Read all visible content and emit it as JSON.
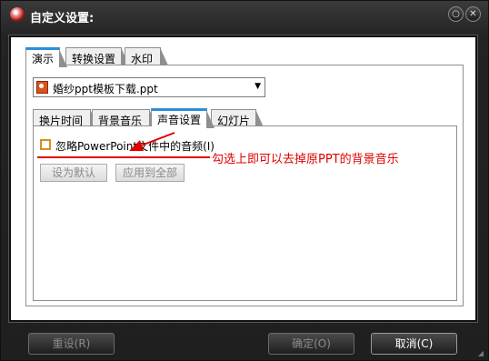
{
  "window": {
    "title": "自定义设置:",
    "min_symbol": "○",
    "close_symbol": "✕"
  },
  "main_tabs": [
    {
      "label": "演示",
      "active": true
    },
    {
      "label": "转换设置",
      "active": false
    },
    {
      "label": "水印",
      "active": false
    }
  ],
  "file_select": {
    "value": "婚纱ppt模板下载.ppt",
    "arrow": "▼"
  },
  "sub_tabs": [
    {
      "label": "换片时间",
      "active": false
    },
    {
      "label": "背景音乐",
      "active": false
    },
    {
      "label": "声音设置",
      "active": true
    },
    {
      "label": "幻灯片",
      "active": false
    }
  ],
  "sound_settings": {
    "ignore_audio_label": "忽略PowerPoint文件中的音频(I)",
    "ignore_audio_checked": false,
    "set_default_label": "设为默认",
    "apply_all_label": "应用到全部"
  },
  "annotation": {
    "text": "勾选上即可以去掉原PPT的背景音乐",
    "color": "#e00000"
  },
  "footer": {
    "reset_label": "重设(R)",
    "ok_label": "确定(O)",
    "cancel_label": "取消(C)"
  },
  "colors": {
    "active_tab_accent": "#2c8fd8",
    "checkbox_border": "#e08a22"
  }
}
